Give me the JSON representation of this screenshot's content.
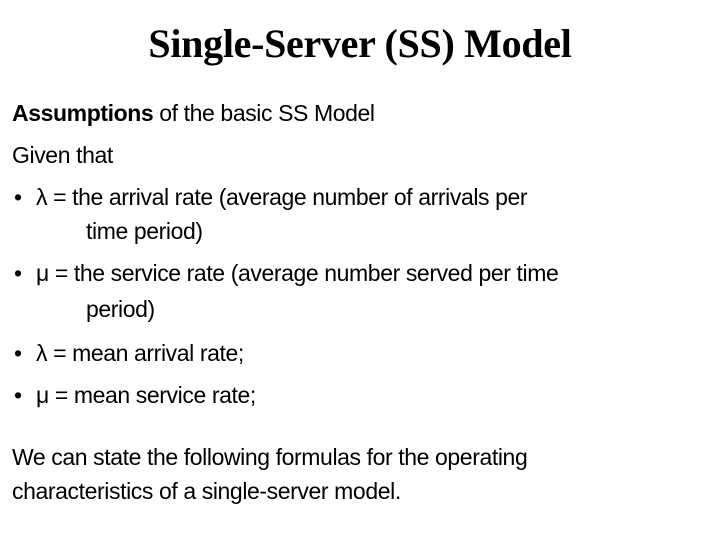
{
  "slide": {
    "title": "Single-Server (SS) Model",
    "intro": {
      "bold": "Assumptions",
      "rest": " of the basic SS Model"
    },
    "given": "Given that",
    "bullet_glyph": "•",
    "bullets": [
      {
        "text": "λ = the arrival rate (average number of arrivals per",
        "continuation": "time period)"
      },
      {
        "text": "μ = the service rate (average number served per time",
        "continuation": "period)"
      },
      {
        "text": "λ = mean arrival rate;"
      },
      {
        "text": "μ = mean service rate;"
      }
    ],
    "closing": {
      "line1": "We can state the following formulas for the operating",
      "line2": "characteristics of a single-server model."
    }
  }
}
